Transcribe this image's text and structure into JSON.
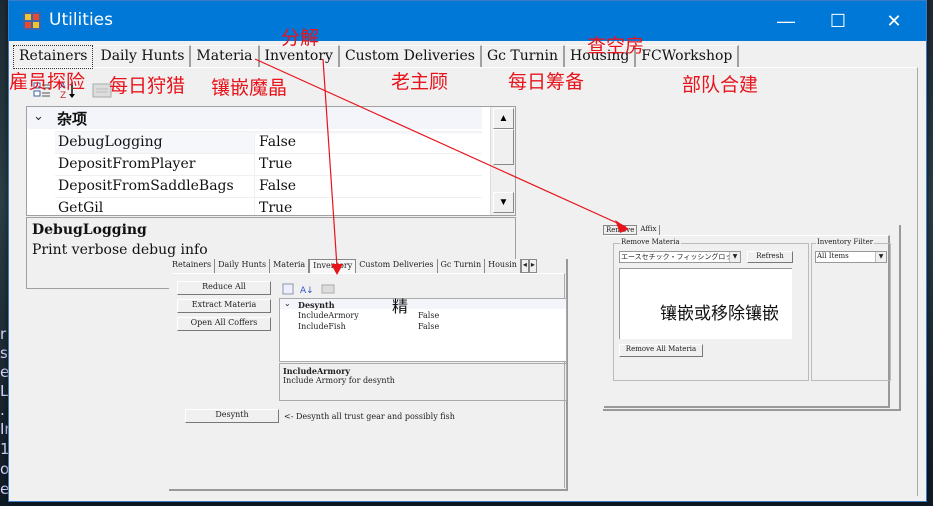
{
  "desktop": {
    "side_text": [
      "r J",
      "s",
      "e",
      "L(",
      ".",
      "Ir",
      "1",
      "oa",
      "e"
    ]
  },
  "window": {
    "title": "Utilities",
    "controls": {
      "minimize": "—",
      "maximize": "☐",
      "close": "✕"
    }
  },
  "tabs": [
    {
      "label": "Retainers",
      "active": true
    },
    {
      "label": "Daily Hunts"
    },
    {
      "label": "Materia"
    },
    {
      "label": "Inventory"
    },
    {
      "label": "Custom Deliveries"
    },
    {
      "label": "Gc Turnin"
    },
    {
      "label": "Housing"
    },
    {
      "label": "FCWorkshop"
    }
  ],
  "annotations": {
    "retainers": "雇员探险",
    "daily_hunts": "每日狩猎",
    "materia": "镶嵌魔晶",
    "inventory": "分解",
    "custom_deliveries": "老主顾",
    "gc_turnin": "每日筹备",
    "housing": "查空房",
    "fcworkshop": "部队合建",
    "materia_panel": "镶嵌或移除镶嵌",
    "inventory_marker": "精",
    "arrow_color": "#e8141c"
  },
  "property_grid": {
    "category": "杂项",
    "rows": [
      {
        "name": "DebugLogging",
        "value": "False"
      },
      {
        "name": "DepositFromPlayer",
        "value": "True"
      },
      {
        "name": "DepositFromSaddleBags",
        "value": "False"
      },
      {
        "name": "GetGil",
        "value": "True"
      }
    ],
    "help_title": "DebugLogging",
    "help_text": "Print verbose debug info"
  },
  "inventory_shot": {
    "tabs": [
      "Retainers",
      "Daily Hunts",
      "Materia",
      "Inventory",
      "Custom Deliveries",
      "Gc Turnin",
      "Housin"
    ],
    "active_tab": "Inventory",
    "buttons": {
      "reduce_all": "Reduce All",
      "extract_materia": "Extract Materia",
      "open_all_coffers": "Open All Coffers",
      "desynth": "Desynth"
    },
    "grid_category": "Desynth",
    "grid_rows": [
      {
        "name": "IncludeArmory",
        "value": "False"
      },
      {
        "name": "IncludeFish",
        "value": "False"
      }
    ],
    "help_title": "IncludeArmory",
    "help_text": "Include Armory for desynth",
    "desynth_note": "<- Desynth all trust gear and possibly fish"
  },
  "materia_shot": {
    "tabs": [
      "Remove",
      "Affix"
    ],
    "active_tab": "Remove",
    "remove_group": "Remove Materia",
    "item_combo": "エースセチック・フィッシングロッ",
    "refresh": "Refresh",
    "remove_all": "Remove All Materia",
    "filter_group": "Inventory Filter",
    "filter_value": "All Items"
  }
}
